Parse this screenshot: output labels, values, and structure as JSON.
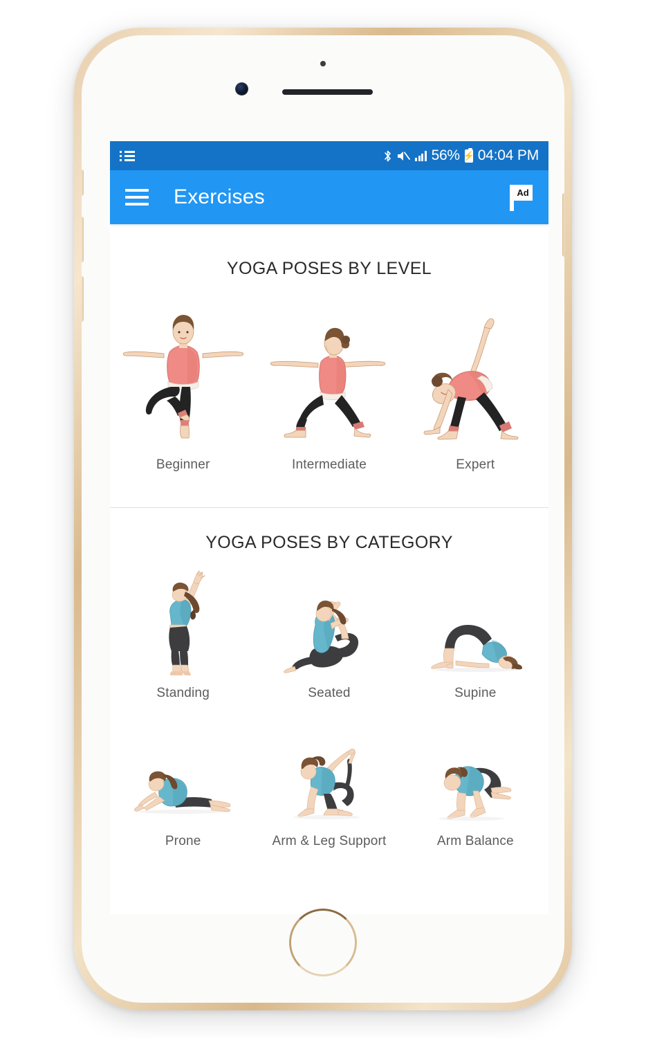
{
  "device": {
    "frame_color": "#e0c29a",
    "body_color": "#fbfbfa",
    "home_button_name": "home-button"
  },
  "status_bar": {
    "background": "#1573c7",
    "notification_icon": "list-notification-icon",
    "bluetooth_icon": "bluetooth-icon",
    "bluetooth_glyph": "✻",
    "mute_icon": "volume-mute-icon",
    "mute_glyph": "🔇",
    "signal_icon": "signal-bars-icon",
    "battery_percent": "56%",
    "battery_icon": "battery-charging-icon",
    "battery_bolt": "⚡",
    "time": "04:04 PM"
  },
  "app_bar": {
    "background": "#2196f3",
    "menu_icon": "hamburger-menu-icon",
    "title": "Exercises",
    "ad_label": "Ad",
    "ad_icon": "ad-flag-icon"
  },
  "sections": [
    {
      "title": "YOGA POSES BY LEVEL",
      "rows": [
        [
          {
            "label": "Beginner",
            "art": "tree-pose"
          },
          {
            "label": "Intermediate",
            "art": "warrior2-pose"
          },
          {
            "label": "Expert",
            "art": "triangle-pose"
          }
        ]
      ]
    },
    {
      "title": "YOGA POSES BY CATEGORY",
      "rows": [
        [
          {
            "label": "Standing",
            "art": "standing-backbend-pose"
          },
          {
            "label": "Seated",
            "art": "seated-mermaid-pose"
          },
          {
            "label": "Supine",
            "art": "bridge-pose"
          }
        ],
        [
          {
            "label": "Prone",
            "art": "sphinx-pose"
          },
          {
            "label": "Arm & Leg Support",
            "art": "kneeling-bow-pose"
          },
          {
            "label": "Arm Balance",
            "art": "crow-pose"
          }
        ]
      ]
    }
  ],
  "colors": {
    "accent": "#2196f3",
    "status_bar": "#1573c7",
    "label_text": "#5c5c5c",
    "title_text": "#2a2a2a",
    "divider": "#dedede",
    "skin": "#f3d5bb",
    "skin_shade": "#e2bb9a",
    "hair": "#7a5434",
    "top_pink": "#ef8a84",
    "top_pink_shade": "#d96f6b",
    "top_teal": "#67b7cc",
    "top_teal_shade": "#4f9db3",
    "pants_black": "#232323",
    "pants_dark": "#3d3d3f",
    "waistband": "#f6eee6"
  }
}
